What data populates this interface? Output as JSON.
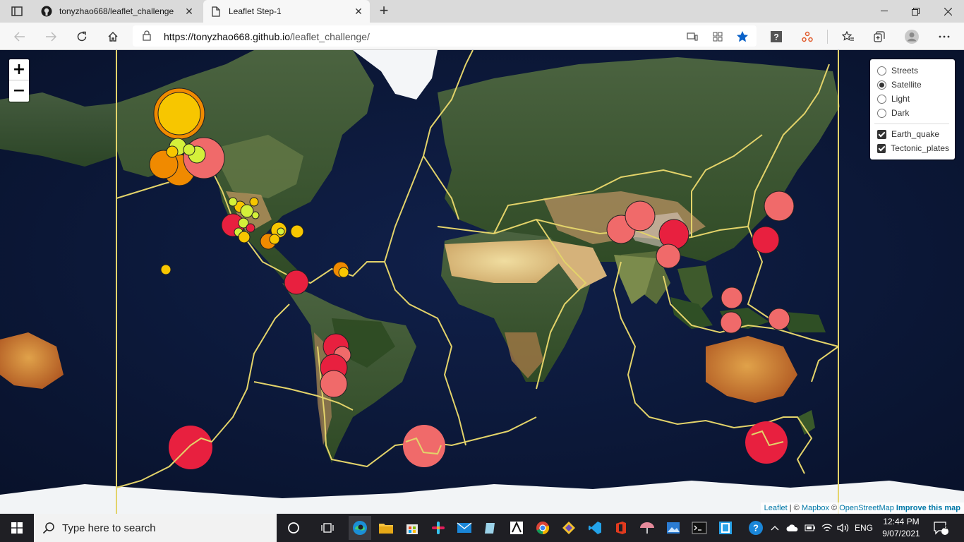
{
  "browser": {
    "tabs": [
      {
        "title": "tonyzhao668/leaflet_challenge",
        "active": false,
        "favicon": "github-icon"
      },
      {
        "title": "Leaflet Step-1",
        "active": true,
        "favicon": "page-icon"
      }
    ],
    "url_host": "https://tonyzhao668.github.io",
    "url_path": "/leaflet_challenge/"
  },
  "map": {
    "zoom_in": "+",
    "zoom_out": "−",
    "base_layers": [
      {
        "label": "Streets",
        "selected": false
      },
      {
        "label": "Satellite",
        "selected": true
      },
      {
        "label": "Light",
        "selected": false
      },
      {
        "label": "Dark",
        "selected": false
      }
    ],
    "overlays": [
      {
        "label": "Earth_quake",
        "checked": true
      },
      {
        "label": "Tectonic_plates",
        "checked": true
      }
    ],
    "attribution": {
      "leaflet": "Leaflet",
      "sep": " | © ",
      "mapbox": "Mapbox",
      "copy2": " © ",
      "osm": "OpenStreetMap",
      "improve": "Improve this map"
    },
    "colors": {
      "plate_line": "#e3d36a",
      "mag_low": "#d4f03a",
      "mag_mid": "#f7c600",
      "mag_high": "#f08a00",
      "mag_top": "#e8203f",
      "mag_pink": "#f06a6a"
    }
  },
  "taskbar": {
    "search_placeholder": "Type here to search",
    "lang": "ENG",
    "time": "12:44 PM",
    "date": "9/07/2021",
    "notifications": "4"
  }
}
